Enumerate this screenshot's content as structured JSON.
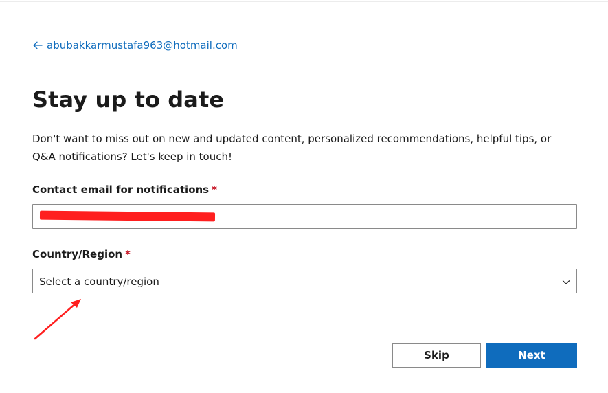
{
  "header": {
    "account_email": "abubakkarmustafa963@hotmail.com",
    "back_icon": "arrow-left-icon"
  },
  "main": {
    "title": "Stay up to date",
    "intro": "Don't want to miss out on new and updated content, personalized recommendations, helpful tips, or Q&A notifications? Let's keep in touch!",
    "email_field": {
      "label": "Contact email for notifications",
      "required_mark": "*",
      "value_redacted": true
    },
    "country_field": {
      "label": "Country/Region",
      "required_mark": "*",
      "selected_value": "Select a country/region",
      "icon": "chevron-down-icon"
    }
  },
  "actions": {
    "skip_label": "Skip",
    "next_label": "Next"
  },
  "colors": {
    "accent": "#0f6cbd",
    "required": "#c50f1f",
    "annotation": "#ff1f1f",
    "text": "#1b1b1b"
  }
}
